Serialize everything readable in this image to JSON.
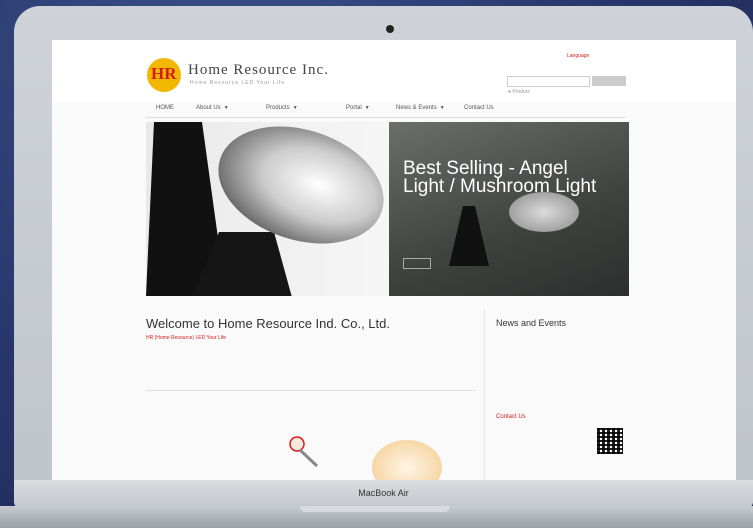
{
  "device": {
    "model": "MacBook Air"
  },
  "site": {
    "logo_text": "HR",
    "brand": "Home Resource Inc.",
    "tagline": "Home Resource LED Your Life",
    "language": "Language",
    "search_placeholder": "",
    "search_button": "",
    "search_option": "Product"
  },
  "nav": {
    "items": [
      {
        "label": "HOME"
      },
      {
        "label": "About Us"
      },
      {
        "label": "Products"
      },
      {
        "label": "Portal"
      },
      {
        "label": "News & Events"
      },
      {
        "label": "Contact Us"
      }
    ]
  },
  "hero": {
    "title": "Best Selling - Angel Light / Mushroom Light",
    "subtitle": "",
    "more": ""
  },
  "welcome": {
    "title": "Welcome to Home Resource Ind. Co., Ltd.",
    "subtitle": "HR (Home Resource) LED Your Life",
    "body": ""
  },
  "news": {
    "title": "News and Events",
    "item1": "",
    "item1_sub": "",
    "item2": "",
    "item2_sub": "",
    "contact_label": "Contact Us",
    "contact_body": ""
  },
  "colors": {
    "accent": "#d61b1b",
    "logo_yellow": "#f2b700",
    "background": "#2b3a6b"
  }
}
